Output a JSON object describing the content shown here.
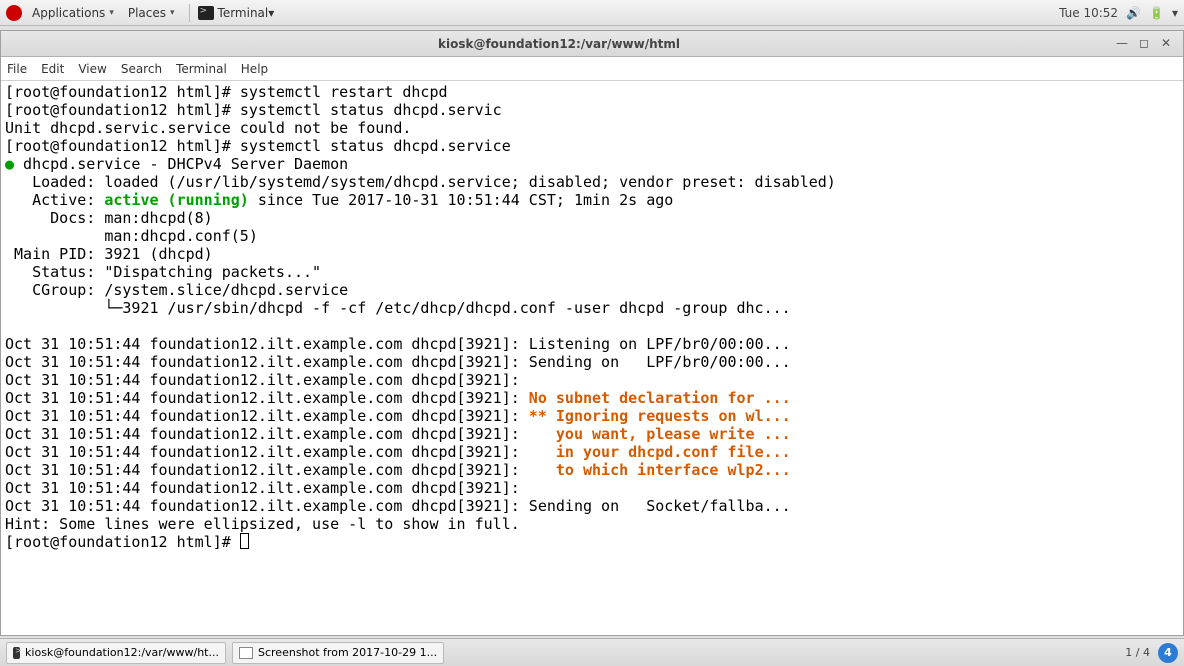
{
  "panel": {
    "applications": "Applications",
    "places": "Places",
    "terminal_label": "Terminal",
    "clock": "Tue 10:52"
  },
  "window": {
    "title": "kiosk@foundation12:/var/www/html",
    "menu": {
      "file": "File",
      "edit": "Edit",
      "view": "View",
      "search": "Search",
      "terminal": "Terminal",
      "help": "Help"
    }
  },
  "term": {
    "prompt": "[root@foundation12 html]# ",
    "cmd_restart": "systemctl restart dhcpd",
    "cmd_status_typo": "systemctl status dhcpd.servic",
    "err_notfound": "Unit dhcpd.servic.service could not be found.",
    "cmd_status": "systemctl status dhcpd.service",
    "svc_line": " dhcpd.service - DHCPv4 Server Daemon",
    "loaded": "   Loaded: loaded (/usr/lib/systemd/system/dhcpd.service; disabled; vendor preset: disabled)",
    "active_pre": "   Active: ",
    "active_green": "active (running)",
    "active_post": " since Tue 2017-10-31 10:51:44 CST; 1min 2s ago",
    "docs1": "     Docs: man:dhcpd(8)",
    "docs2": "           man:dhcpd.conf(5)",
    "pid": " Main PID: 3921 (dhcpd)",
    "status": "   Status: \"Dispatching packets...\"",
    "cgroup": "   CGroup: /system.slice/dhcpd.service",
    "cgroup2": "           └─3921 /usr/sbin/dhcpd -f -cf /etc/dhcp/dhcpd.conf -user dhcpd -group dhc...",
    "log_prefix": "Oct 31 10:51:44 foundation12.ilt.example.com dhcpd[3921]: ",
    "log1_post": "Listening on LPF/br0/00:00...",
    "log2_post": "Sending on   LPF/br0/00:00...",
    "warn1": "No subnet declaration for ...",
    "warn2": "** Ignoring requests on wl...",
    "warn3": "   you want, please write ...",
    "warn4": "   in your dhcpd.conf file...",
    "warn5": "   to which interface wlp2...",
    "log9_post": "Sending on   Socket/fallba...",
    "hint": "Hint: Some lines were ellipsized, use -l to show in full."
  },
  "taskbar": {
    "task1": "kiosk@foundation12:/var/www/ht...",
    "task2": "Screenshot from 2017-10-29 1...",
    "workspace": "1 / 4",
    "badge": "4"
  }
}
